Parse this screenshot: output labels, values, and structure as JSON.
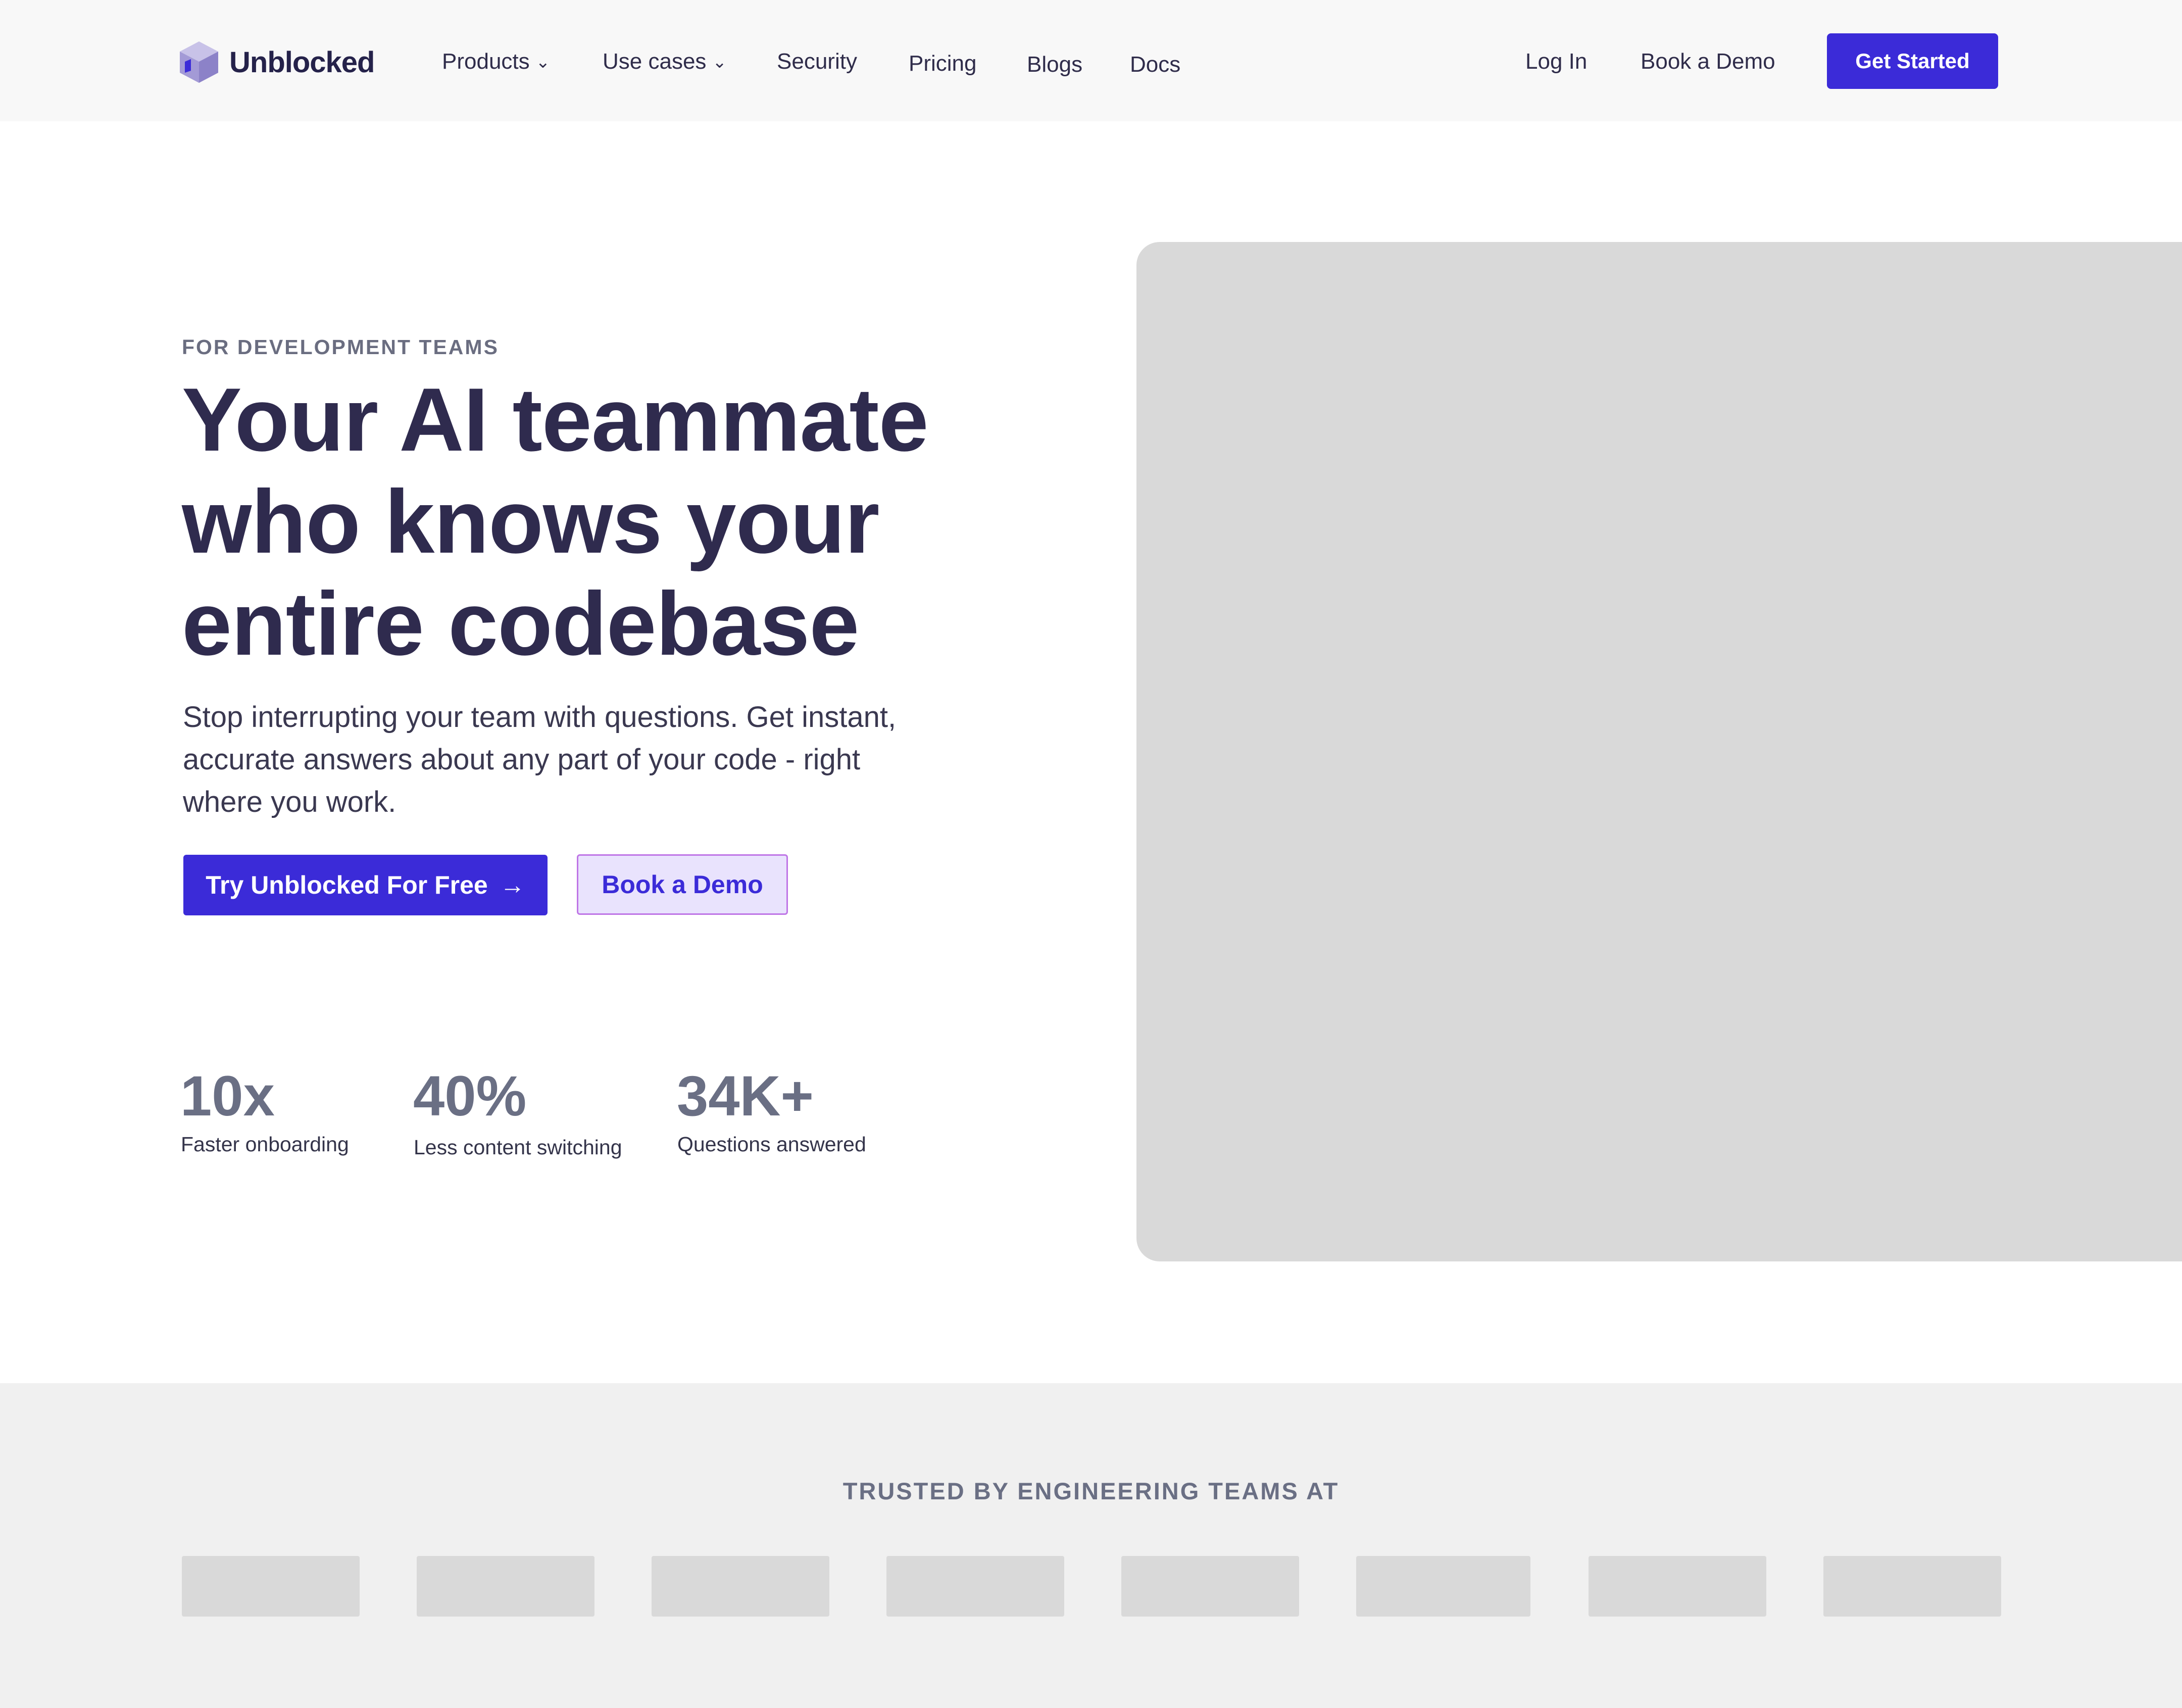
{
  "nav": {
    "brand": "Unblocked",
    "items": [
      {
        "label": "Products",
        "has_dropdown": true
      },
      {
        "label": "Use cases",
        "has_dropdown": true
      },
      {
        "label": "Security",
        "has_dropdown": false
      },
      {
        "label": "Pricing",
        "has_dropdown": false
      },
      {
        "label": "Blogs",
        "has_dropdown": false
      },
      {
        "label": "Docs",
        "has_dropdown": false
      }
    ],
    "chevron": "⌄",
    "login": "Log In",
    "book_demo": "Book a Demo",
    "get_started": "Get Started"
  },
  "hero": {
    "eyebrow": "FOR DEVELOPMENT TEAMS",
    "headline_line1": "Your AI teammate",
    "headline_line2": "who knows your",
    "headline_line3": "entire codebase",
    "subtext": "Stop interrupting your team with questions. Get instant, accurate answers about any part of your code - right where you work.",
    "primary_cta": "Try Unblocked For Free",
    "primary_cta_arrow": "→",
    "secondary_cta": "Book a Demo"
  },
  "stats": [
    {
      "value": "10x",
      "label": "Faster onboarding"
    },
    {
      "value": "40%",
      "label": "Less content switching"
    },
    {
      "value": "34K+",
      "label": "Questions answered"
    }
  ],
  "trusted": {
    "title": "TRUSTED BY ENGINEERING TEAMS AT"
  },
  "colors": {
    "accent": "#3b2bd8",
    "heading": "#2f2b4e",
    "muted": "#6a6f84",
    "placeholder": "#d9d9d9",
    "secondary_bg": "#e9e3fd",
    "secondary_border": "#bf76e6"
  }
}
